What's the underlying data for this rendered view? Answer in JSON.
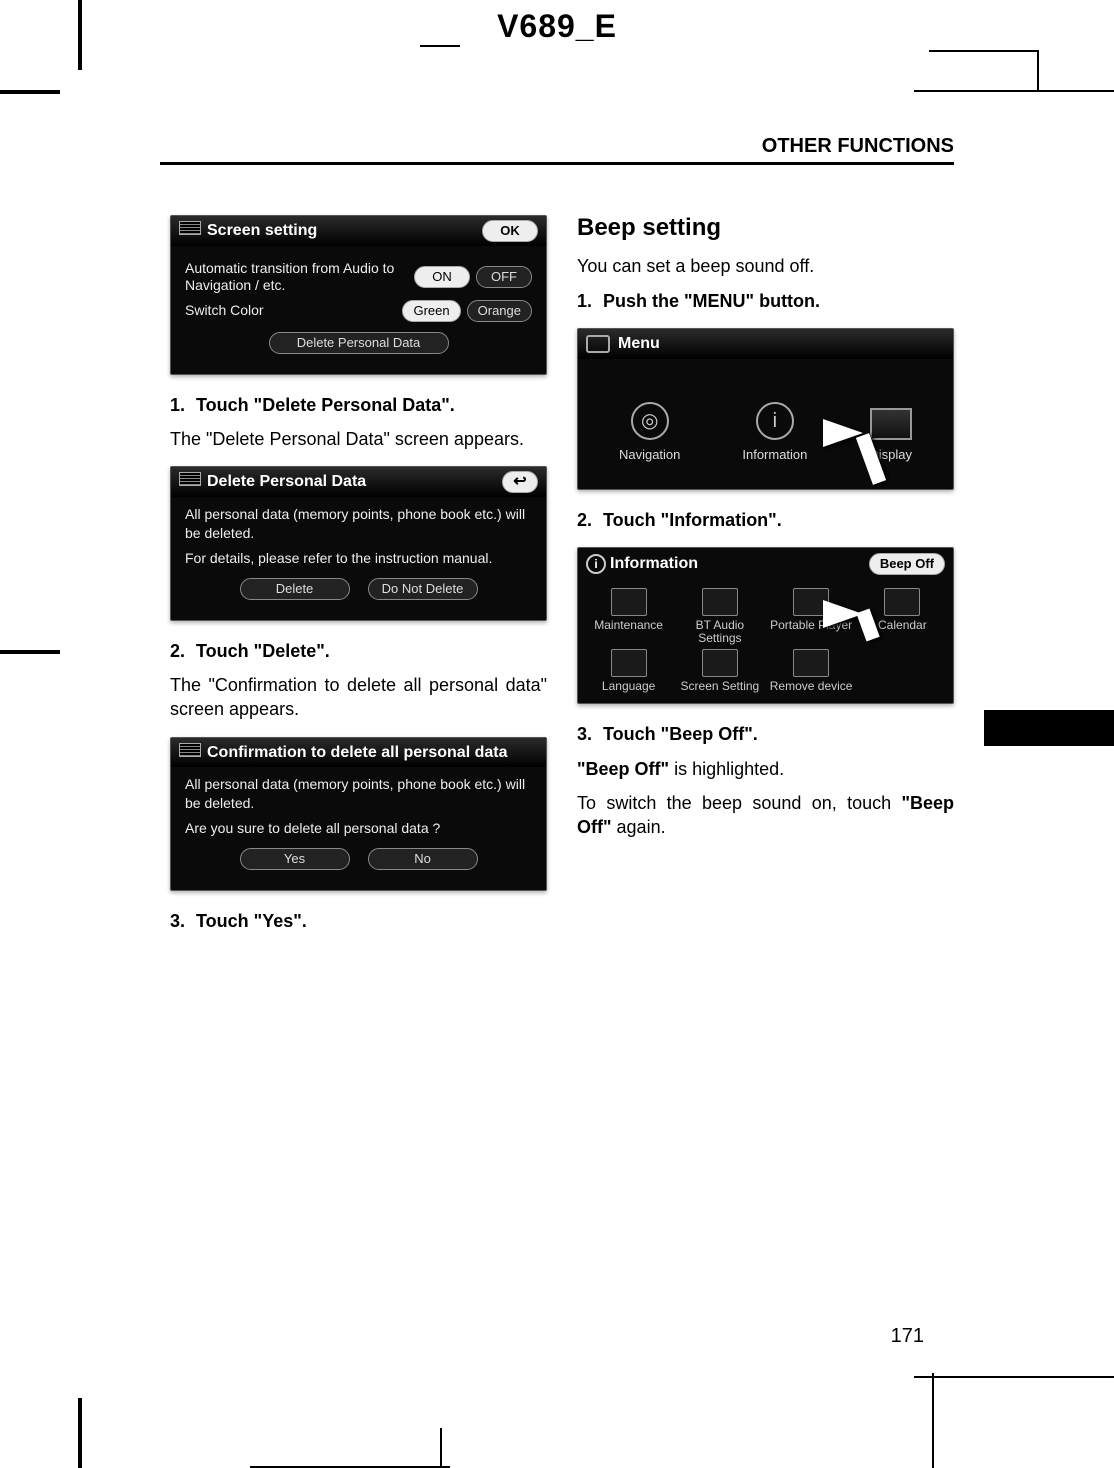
{
  "doc_header": "V689_E",
  "section_header": "OTHER FUNCTIONS",
  "page_number": "171",
  "left": {
    "screen_setting": {
      "title": "Screen setting",
      "ok": "OK",
      "row1_label": "Automatic transition from Audio to Navigation / etc.",
      "on": "ON",
      "off": "OFF",
      "row2_label": "Switch Color",
      "green": "Green",
      "orange": "Orange",
      "delete_btn": "Delete Personal Data"
    },
    "step1": "Touch \"Delete Personal Data\".",
    "step1_body": "The \"Delete Personal Data\" screen appears.",
    "delete_panel": {
      "title": "Delete Personal Data",
      "line1": "All personal data (memory points, phone book etc.) will be deleted.",
      "line2": "For details, please refer to the instruction manual.",
      "delete": "Delete",
      "dont": "Do Not Delete"
    },
    "step2": "Touch \"Delete\".",
    "step2_body": "The \"Confirmation to delete all personal data\" screen appears.",
    "confirm_panel": {
      "title": "Confirmation to delete all personal data",
      "line1": "All personal data (memory points, phone book etc.) will be deleted.",
      "line2": "Are you sure to delete all personal data ?",
      "yes": "Yes",
      "no": "No"
    },
    "step3": "Touch \"Yes\"."
  },
  "right": {
    "heading": "Beep setting",
    "intro": "You can set a beep sound off.",
    "step1": "Push the \"MENU\" button.",
    "menu_panel": {
      "title": "Menu",
      "items": [
        "Navigation",
        "Information",
        "Display"
      ]
    },
    "step2": "Touch \"Information\".",
    "info_panel": {
      "title": "Information",
      "beep_off": "Beep Off",
      "items": [
        "Maintenance",
        "BT Audio Settings",
        "Portable Player",
        "Calendar",
        "Language",
        "Screen Setting",
        "Remove device"
      ]
    },
    "step3": "Touch \"Beep Off\".",
    "body1a": "\"Beep Off\"",
    "body1b": " is highlighted.",
    "body2a": "To switch the beep sound on, touch ",
    "body2b": "\"Beep Off\"",
    "body2c": " again."
  }
}
